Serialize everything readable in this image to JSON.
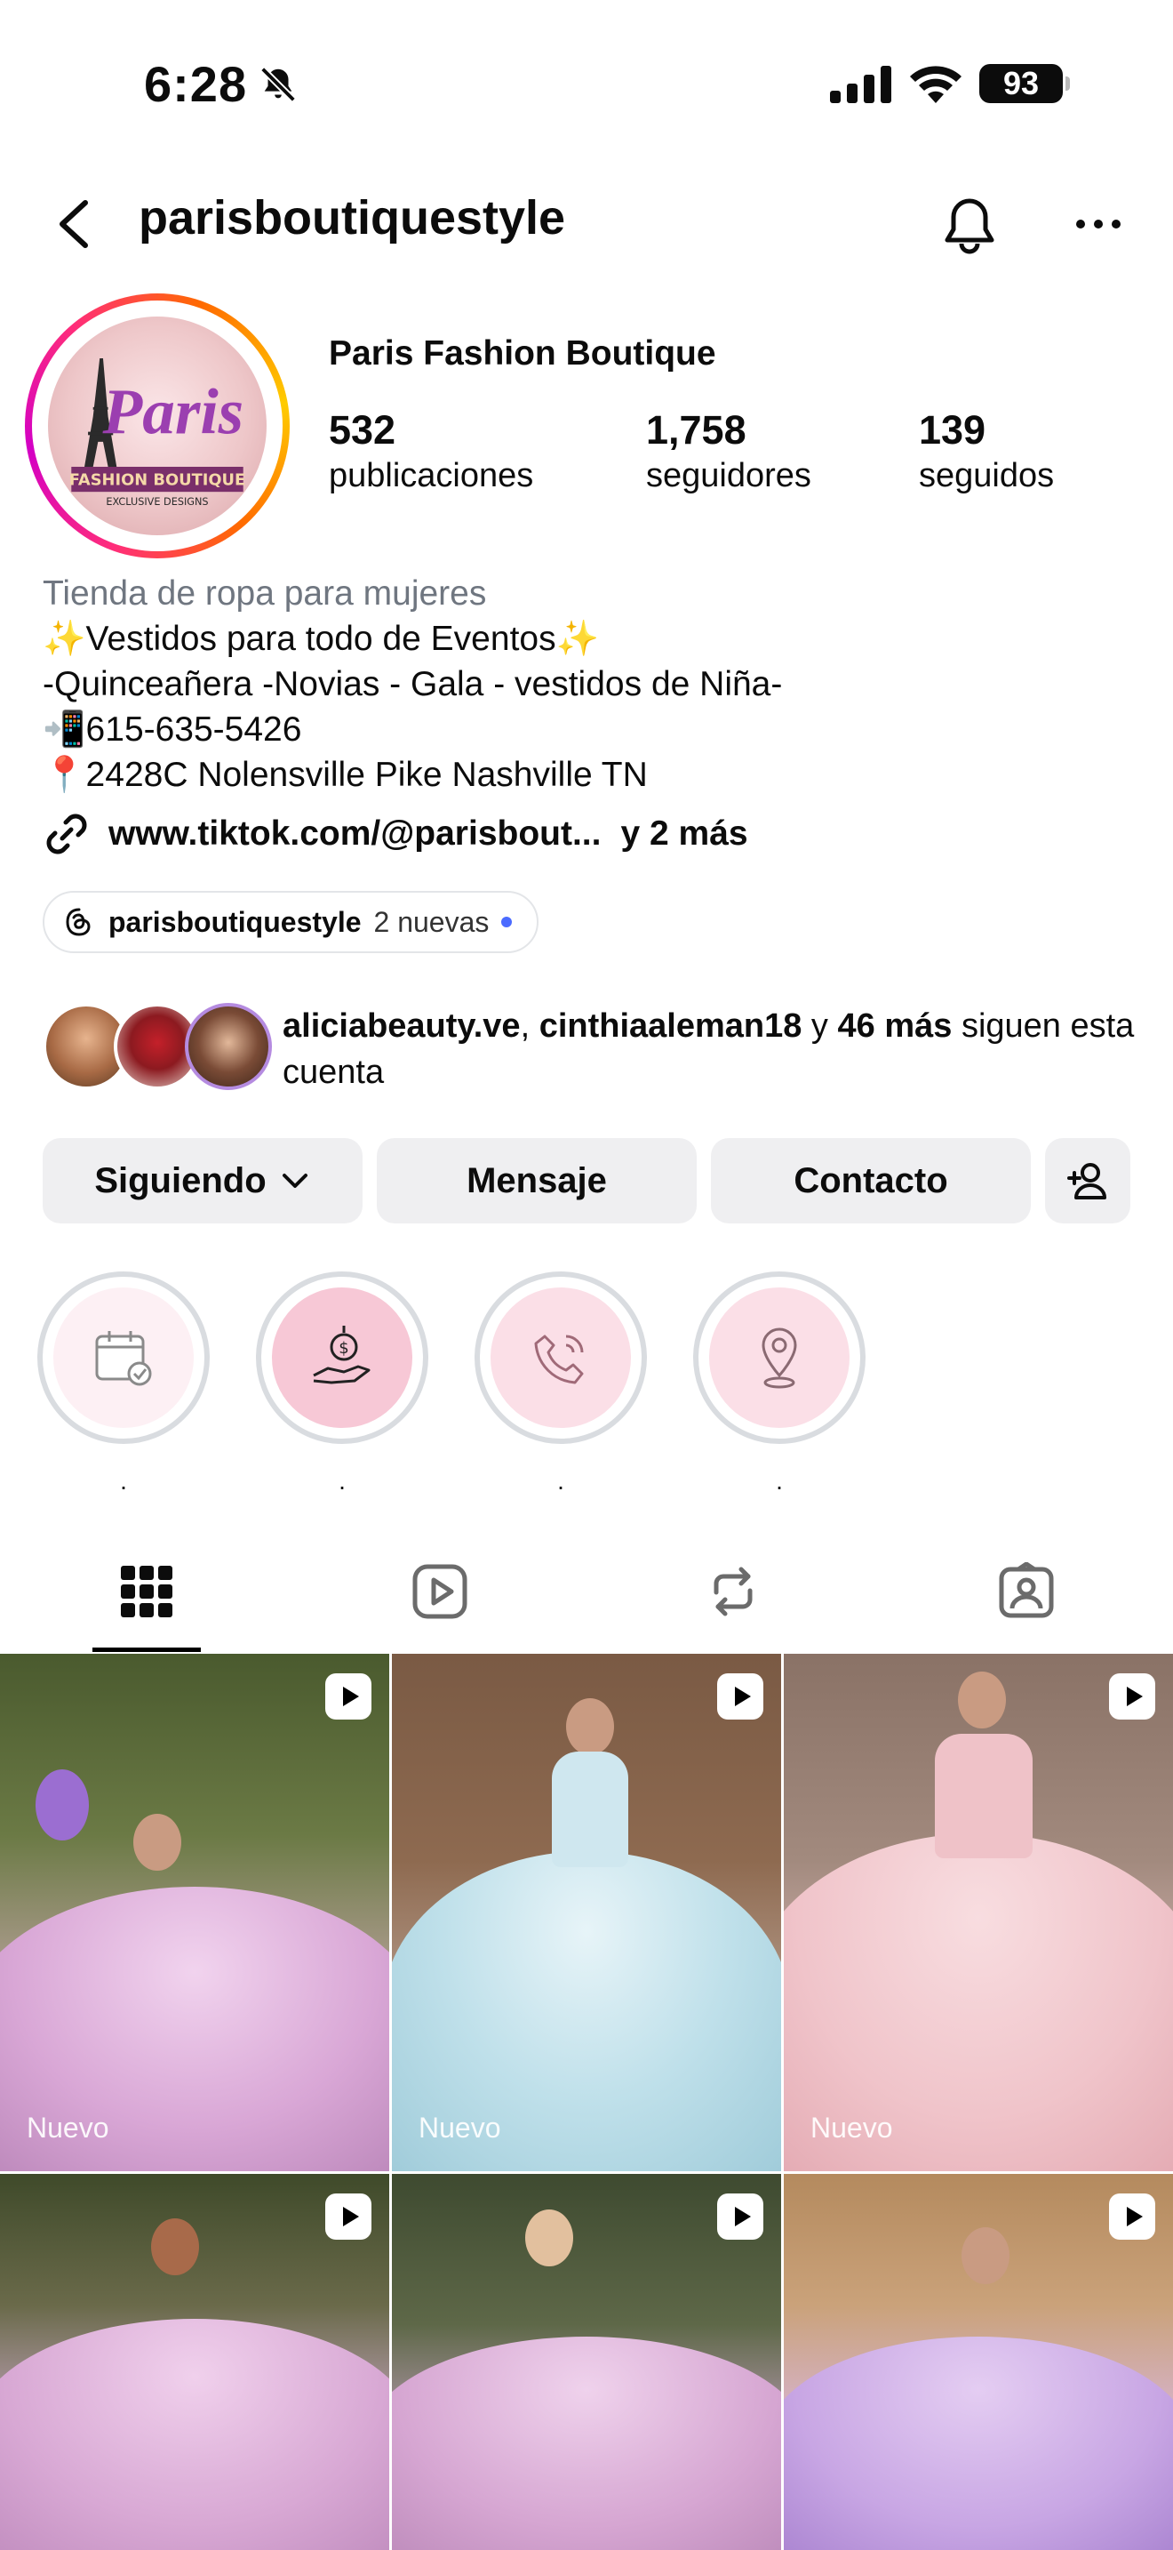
{
  "status_bar": {
    "time": "6:28",
    "battery": "93",
    "icons": [
      "bell-off-icon",
      "signal-icon",
      "wifi-icon",
      "battery-icon"
    ]
  },
  "header": {
    "username": "parisboutiquestyle"
  },
  "profile": {
    "display_name": "Paris Fashion Boutique",
    "avatar_text": {
      "line1": "Paris",
      "line2": "FASHION BOUTIQUE",
      "line3": "EXCLUSIVE DESIGNS"
    },
    "stats": [
      {
        "value": "532",
        "label": "publicaciones"
      },
      {
        "value": "1,758",
        "label": "seguidores"
      },
      {
        "value": "139",
        "label": "seguidos"
      }
    ],
    "bio": {
      "category": "Tienda de ropa para mujeres",
      "lines": [
        "✨Vestidos para todo de Eventos✨",
        "-Quinceañera -Novias - Gala - vestidos de Niña-",
        "📲615-635-5426",
        "📍2428C Nolensville Pike Nashville TN"
      ]
    },
    "link": {
      "text": "www.tiktok.com/@parisbout...",
      "more": "y 2 más"
    },
    "threads": {
      "username": "parisboutiquestyle",
      "badge": "2 nuevas"
    },
    "followed_by": {
      "user1": "aliciabeauty.ve",
      "sep": ", ",
      "user2": "cinthiaaleman18",
      "and": " y ",
      "count": "46 más",
      "rest": " siguen esta cuenta"
    }
  },
  "buttons": {
    "following": "Siguiendo",
    "message": "Mensaje",
    "contact": "Contacto"
  },
  "highlights": [
    {
      "label": ".",
      "icon": "calendar-check-icon"
    },
    {
      "label": ".",
      "icon": "money-hand-icon"
    },
    {
      "label": ".",
      "icon": "phone-icon"
    },
    {
      "label": ".",
      "icon": "location-pin-icon"
    }
  ],
  "tabs": [
    "grid-tab",
    "reels-tab",
    "reposts-tab",
    "tagged-tab"
  ],
  "posts": [
    {
      "badge": "Nuevo"
    },
    {
      "badge": "Nuevo"
    },
    {
      "badge": "Nuevo"
    },
    {
      "badge": ""
    },
    {
      "badge": ""
    },
    {
      "badge": ""
    }
  ],
  "colors": {
    "accent_blue": "#4b6bff",
    "button_bg": "#efeff1",
    "highlight_bg": "#fbdfe7"
  }
}
